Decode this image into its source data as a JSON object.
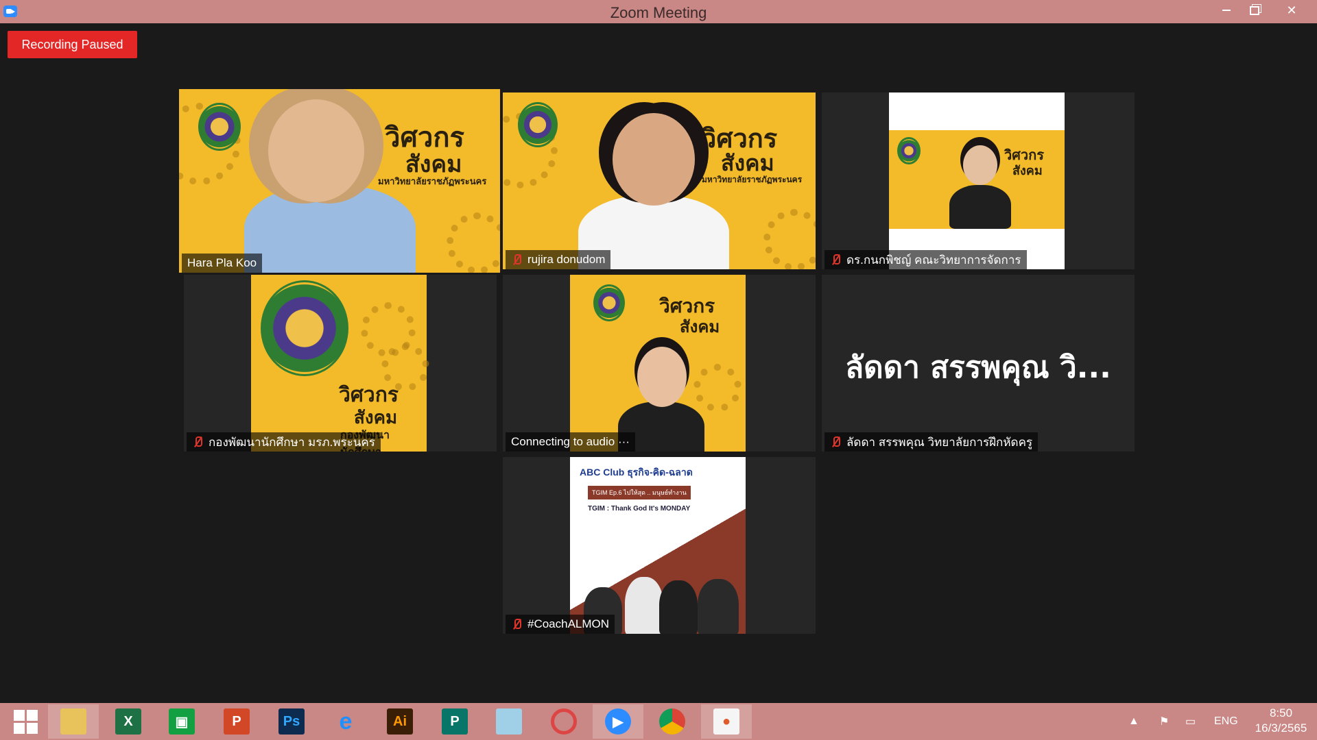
{
  "window": {
    "title": "Zoom Meeting"
  },
  "recording": {
    "label": "Recording Paused"
  },
  "tiles": [
    {
      "name": "Hara Pla Koo",
      "muted": false,
      "active": true
    },
    {
      "name": "rujira donudom",
      "muted": true
    },
    {
      "name": "ดร.กนกพิชญ์ คณะวิทยาการจัดการ",
      "muted": true
    },
    {
      "name": "กองพัฒนานักศึกษา มรภ.พระนคร",
      "muted": true
    },
    {
      "name": "Connecting to audio ···",
      "muted": false
    },
    {
      "name": "ลัดดา สรรพคุณ วิทยาลัยการฝึกหัดครู",
      "muted": true,
      "display_name": "ลัดดา สรรพคุณ วิ..."
    },
    {
      "name": "#CoachALMON",
      "muted": true
    }
  ],
  "backgrounds": {
    "vb_title_1": "วิศวกร",
    "vb_title_2": "สังคม",
    "vb_univ": "มหาวิทยาลัยราชภัฏพระนคร",
    "vb_office": "กองพัฒนานักศึกษา",
    "poster_title": "ABC Club ธุรกิจ-คิด-ฉลาด",
    "poster_sub": "TGIM Ep.6 ไปให้สุด .. มนุษย์ทำงาน",
    "poster_line": "TGIM : Thank God It's MONDAY"
  },
  "taskbar": {
    "apps": [
      "start",
      "file-explorer",
      "excel",
      "store",
      "powerpoint",
      "photoshop",
      "internet-explorer",
      "illustrator",
      "publisher",
      "notes",
      "photoscape",
      "zoom",
      "chrome",
      "paint"
    ],
    "language": "ENG",
    "time": "8:50",
    "date": "16/3/2565"
  },
  "colors": {
    "titlebar": "#c98785",
    "recording": "#e32726",
    "active_speaker": "#c7e53b",
    "background_yellow": "#f3bb2a"
  }
}
